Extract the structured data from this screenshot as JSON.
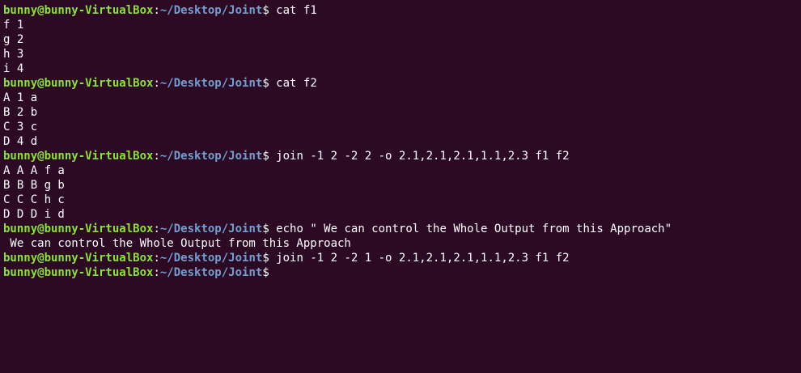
{
  "prompt": {
    "user_host": "bunny@bunny-VirtualBox",
    "separator": ":",
    "path": "~/Desktop/Joint",
    "dollar": "$"
  },
  "lines": [
    {
      "type": "prompt",
      "command": " cat f1"
    },
    {
      "type": "output",
      "text": "f 1"
    },
    {
      "type": "output",
      "text": "g 2"
    },
    {
      "type": "output",
      "text": "h 3"
    },
    {
      "type": "output",
      "text": "i 4"
    },
    {
      "type": "prompt",
      "command": " cat f2"
    },
    {
      "type": "output",
      "text": "A 1 a"
    },
    {
      "type": "output",
      "text": "B 2 b"
    },
    {
      "type": "output",
      "text": "C 3 c"
    },
    {
      "type": "output",
      "text": "D 4 d"
    },
    {
      "type": "prompt",
      "command": " join -1 2 -2 2 -o 2.1,2.1,2.1,1.1,2.3 f1 f2"
    },
    {
      "type": "output",
      "text": "A A A f a"
    },
    {
      "type": "output",
      "text": "B B B g b"
    },
    {
      "type": "output",
      "text": "C C C h c"
    },
    {
      "type": "output",
      "text": "D D D i d"
    },
    {
      "type": "prompt",
      "command": " echo \" We can control the Whole Output from this Approach\""
    },
    {
      "type": "output",
      "text": " We can control the Whole Output from this Approach"
    },
    {
      "type": "prompt",
      "command": " join -1 2 -2 1 -o 2.1,2.1,2.1,1.1,2.3 f1 f2"
    },
    {
      "type": "prompt",
      "command": ""
    }
  ]
}
